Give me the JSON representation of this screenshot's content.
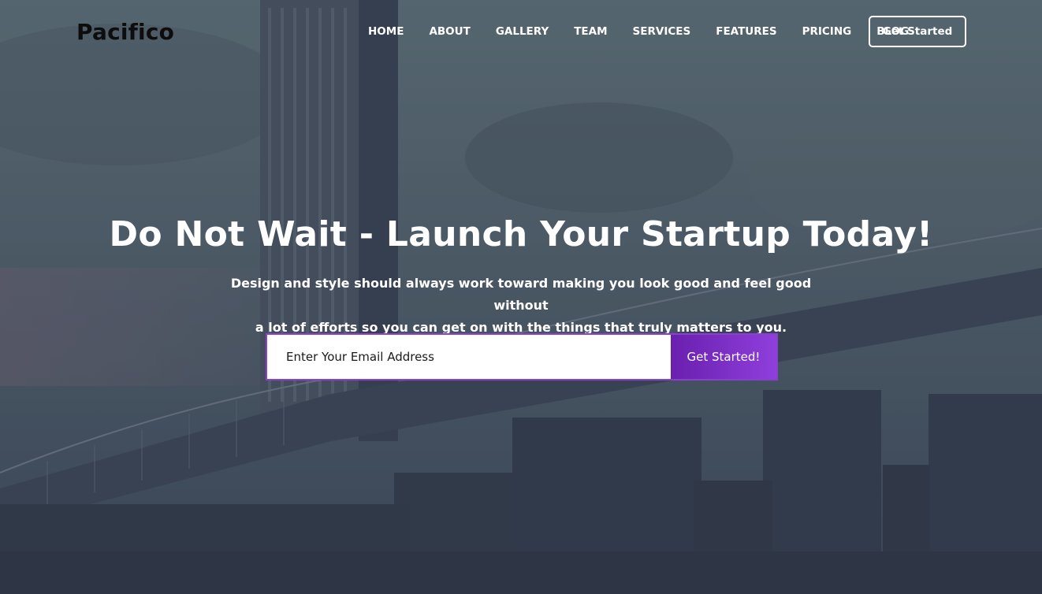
{
  "brand": {
    "name": "Pacifico"
  },
  "nav": {
    "items": [
      {
        "label": "HOME"
      },
      {
        "label": "ABOUT"
      },
      {
        "label": "GALLERY"
      },
      {
        "label": "TEAM"
      },
      {
        "label": "SERVICES"
      },
      {
        "label": "FEATURES"
      },
      {
        "label": "PRICING"
      },
      {
        "label": "BLOG"
      }
    ],
    "cta_label": "Get Started"
  },
  "hero": {
    "headline": "Do Not Wait - Launch Your Startup Today!",
    "subtext_line1": "Design and style should always work toward making you look good and feel good without",
    "subtext_line2": "a lot of efforts so you can get on with the things that truly matters to you.",
    "email_placeholder": "Enter Your Email Address",
    "submit_label": "Get Started!"
  },
  "colors": {
    "accent": "#8b3fd1",
    "button_start": "#6a1fae",
    "button_end": "#8f3fdc",
    "text_light": "#ffffff",
    "brand_text": "#0d0d0d"
  }
}
